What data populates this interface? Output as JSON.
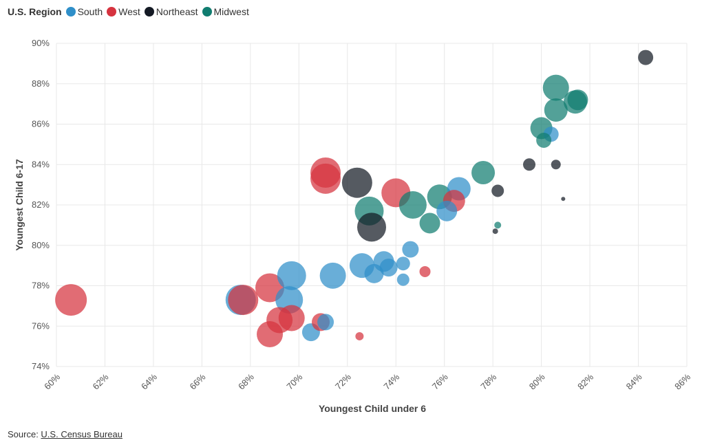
{
  "legend": {
    "title": "U.S. Region",
    "items": [
      {
        "label": "South",
        "color": "#2f8fc9"
      },
      {
        "label": "West",
        "color": "#d6333f"
      },
      {
        "label": "Northeast",
        "color": "#141a24"
      },
      {
        "label": "Midwest",
        "color": "#117d70"
      }
    ]
  },
  "source": {
    "prefix": "Source: ",
    "link": "U.S. Census Bureau"
  },
  "chart_data": {
    "type": "scatter",
    "title": "",
    "xlabel": "Youngest Child under 6",
    "ylabel": "Youngest Child 6-17",
    "xlim": [
      60,
      86
    ],
    "ylim": [
      74,
      90
    ],
    "xticks": [
      "60%",
      "62%",
      "64%",
      "66%",
      "68%",
      "70%",
      "72%",
      "74%",
      "76%",
      "78%",
      "80%",
      "82%",
      "84%",
      "86%"
    ],
    "yticks": [
      "74%",
      "76%",
      "78%",
      "80%",
      "82%",
      "84%",
      "86%",
      "88%",
      "90%"
    ],
    "grid": true,
    "legend_position": "top-left",
    "size_note": "bubble size relative",
    "points": [
      {
        "region": "West",
        "x": 60.6,
        "y": 77.3,
        "size": 23
      },
      {
        "region": "South",
        "x": 67.6,
        "y": 77.3,
        "size": 22
      },
      {
        "region": "West",
        "x": 67.7,
        "y": 77.3,
        "size": 22
      },
      {
        "region": "West",
        "x": 68.8,
        "y": 77.9,
        "size": 21
      },
      {
        "region": "South",
        "x": 69.7,
        "y": 78.5,
        "size": 21
      },
      {
        "region": "South",
        "x": 69.6,
        "y": 77.3,
        "size": 20
      },
      {
        "region": "West",
        "x": 69.2,
        "y": 76.3,
        "size": 19
      },
      {
        "region": "West",
        "x": 69.7,
        "y": 76.4,
        "size": 19
      },
      {
        "region": "West",
        "x": 68.8,
        "y": 75.6,
        "size": 19
      },
      {
        "region": "South",
        "x": 70.5,
        "y": 75.7,
        "size": 13
      },
      {
        "region": "West",
        "x": 70.9,
        "y": 76.2,
        "size": 13
      },
      {
        "region": "South",
        "x": 71.1,
        "y": 76.2,
        "size": 12
      },
      {
        "region": "West",
        "x": 72.5,
        "y": 75.5,
        "size": 6
      },
      {
        "region": "South",
        "x": 71.4,
        "y": 78.5,
        "size": 19
      },
      {
        "region": "South",
        "x": 72.6,
        "y": 79.0,
        "size": 18
      },
      {
        "region": "South",
        "x": 73.1,
        "y": 78.6,
        "size": 14
      },
      {
        "region": "South",
        "x": 73.5,
        "y": 79.2,
        "size": 15
      },
      {
        "region": "South",
        "x": 73.7,
        "y": 78.9,
        "size": 13
      },
      {
        "region": "South",
        "x": 74.3,
        "y": 79.1,
        "size": 10
      },
      {
        "region": "South",
        "x": 74.3,
        "y": 78.3,
        "size": 9
      },
      {
        "region": "South",
        "x": 74.6,
        "y": 79.8,
        "size": 12
      },
      {
        "region": "West",
        "x": 75.2,
        "y": 78.7,
        "size": 8
      },
      {
        "region": "West",
        "x": 71.1,
        "y": 83.6,
        "size": 22
      },
      {
        "region": "West",
        "x": 71.1,
        "y": 83.3,
        "size": 22
      },
      {
        "region": "Northeast",
        "x": 72.4,
        "y": 83.1,
        "size": 22
      },
      {
        "region": "West",
        "x": 74.0,
        "y": 82.6,
        "size": 21
      },
      {
        "region": "Midwest",
        "x": 72.9,
        "y": 81.7,
        "size": 21
      },
      {
        "region": "Northeast",
        "x": 73.0,
        "y": 80.9,
        "size": 21
      },
      {
        "region": "Midwest",
        "x": 74.7,
        "y": 82.0,
        "size": 20
      },
      {
        "region": "Midwest",
        "x": 75.8,
        "y": 82.4,
        "size": 18
      },
      {
        "region": "South",
        "x": 76.6,
        "y": 82.8,
        "size": 17
      },
      {
        "region": "West",
        "x": 76.4,
        "y": 82.2,
        "size": 16
      },
      {
        "region": "South",
        "x": 76.1,
        "y": 81.7,
        "size": 15
      },
      {
        "region": "Midwest",
        "x": 75.4,
        "y": 81.1,
        "size": 15
      },
      {
        "region": "Midwest",
        "x": 77.6,
        "y": 83.6,
        "size": 17
      },
      {
        "region": "Northeast",
        "x": 78.2,
        "y": 82.7,
        "size": 9
      },
      {
        "region": "Midwest",
        "x": 78.2,
        "y": 81.0,
        "size": 5
      },
      {
        "region": "Northeast",
        "x": 78.1,
        "y": 80.7,
        "size": 4
      },
      {
        "region": "Midwest",
        "x": 80.6,
        "y": 87.8,
        "size": 19
      },
      {
        "region": "Midwest",
        "x": 80.6,
        "y": 86.7,
        "size": 17
      },
      {
        "region": "Midwest",
        "x": 81.4,
        "y": 87.1,
        "size": 17
      },
      {
        "region": "Midwest",
        "x": 81.5,
        "y": 87.2,
        "size": 15
      },
      {
        "region": "Midwest",
        "x": 80.0,
        "y": 85.8,
        "size": 16
      },
      {
        "region": "South",
        "x": 80.4,
        "y": 85.5,
        "size": 11
      },
      {
        "region": "Midwest",
        "x": 80.1,
        "y": 85.2,
        "size": 11
      },
      {
        "region": "Northeast",
        "x": 79.5,
        "y": 84.0,
        "size": 9
      },
      {
        "region": "Northeast",
        "x": 80.6,
        "y": 84.0,
        "size": 7
      },
      {
        "region": "Northeast",
        "x": 80.9,
        "y": 82.3,
        "size": 3
      },
      {
        "region": "Northeast",
        "x": 84.3,
        "y": 89.3,
        "size": 11
      }
    ]
  }
}
